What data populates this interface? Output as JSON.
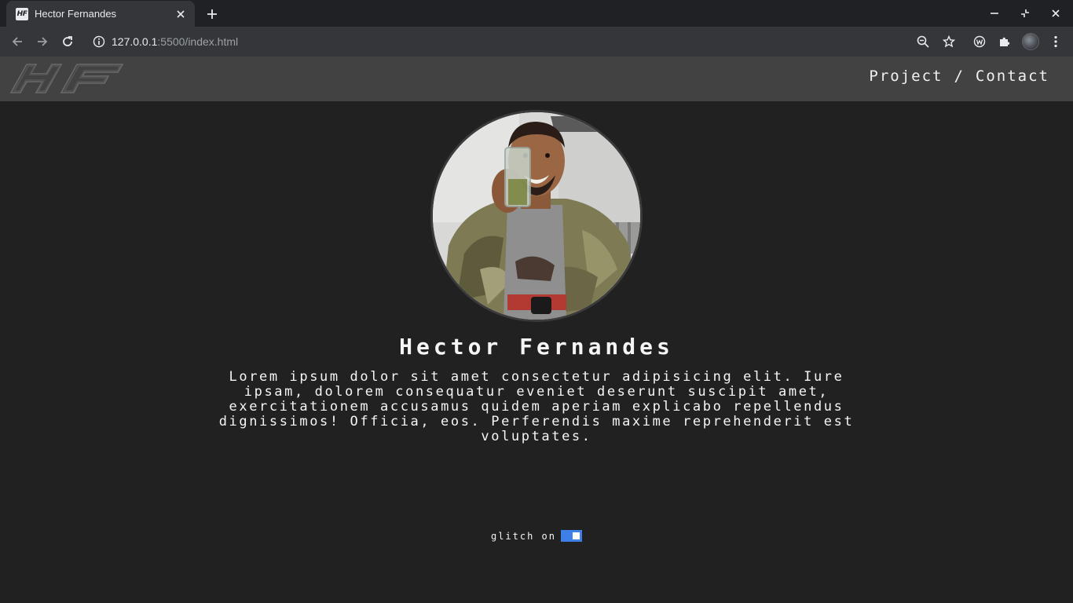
{
  "browser": {
    "tab_title": "Hector Fernandes",
    "favicon_text": "HF",
    "url_host": "127.0.0.1",
    "url_rest": ":5500/index.html"
  },
  "site": {
    "nav": {
      "project": "Project",
      "separator": "/",
      "contact": "Contact"
    },
    "name": "Hector Fernandes",
    "bio": "Lorem ipsum dolor sit amet consectetur adipisicing elit. Iure ipsam, dolorem consequatur eveniet deserunt suscipit amet, exercitationem accusamus quidem aperiam explicabo repellendus dignissimos! Officia, eos. Perferendis maxime reprehenderit est voluptates.",
    "glitch": {
      "label": "glitch on",
      "enabled": true,
      "toggle_color": "#3f7fe8"
    },
    "colors": {
      "background": "#212121",
      "header": "#424242",
      "text": "#f5f5f5"
    }
  },
  "icons": {
    "favicon": "hf-logo-icon",
    "close": "close-icon",
    "new_tab": "plus-icon",
    "back": "arrow-left-icon",
    "forward": "arrow-right-icon",
    "reload": "reload-icon",
    "info": "info-icon",
    "zoom": "zoom-out-icon",
    "bookmark": "star-icon",
    "extension1": "w-extension-icon",
    "extensions": "puzzle-icon",
    "menu": "kebab-menu-icon"
  }
}
